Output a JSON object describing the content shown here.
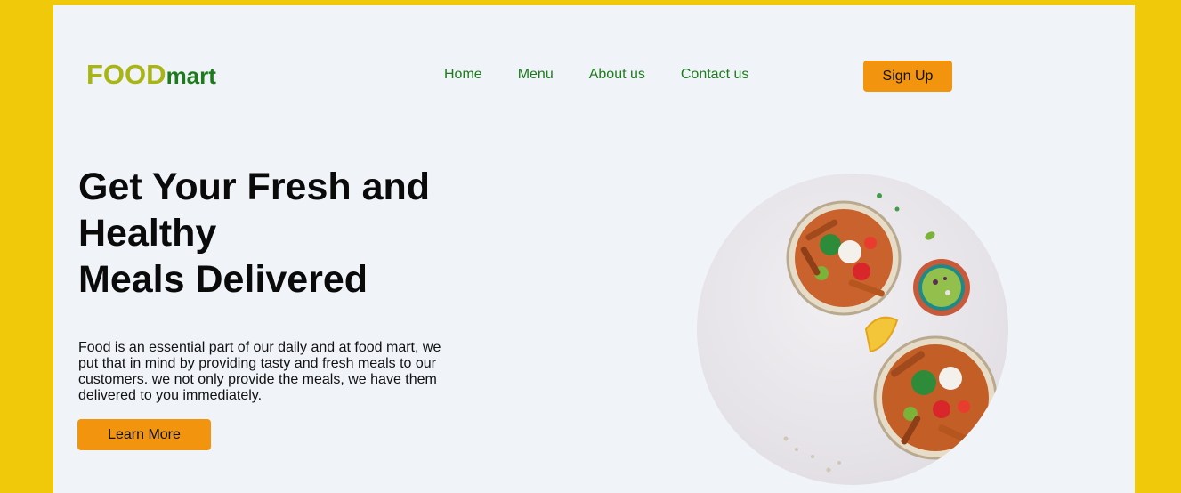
{
  "brand": {
    "part1": "FOOD",
    "part2": "mart"
  },
  "nav": {
    "items": [
      "Home",
      "Menu",
      "About us",
      "Contact us"
    ]
  },
  "signup_label": "Sign Up",
  "hero": {
    "title_line1": "Get Your Fresh and",
    "title_line2": "Healthy",
    "title_line3": "Meals Delivered",
    "description": "Food is an essential part of our daily and at food mart, we put that in mind by providing tasty and fresh meals to our customers. we not only provide the meals, we have them delivered to you immediately.",
    "learn_more_label": "Learn More"
  },
  "colors": {
    "background_frame": "#f0c90a",
    "page": "#f0f4f8",
    "accent_orange": "#f2940d",
    "logo_olive": "#a9b514",
    "nav_green": "#1d7a1d"
  }
}
